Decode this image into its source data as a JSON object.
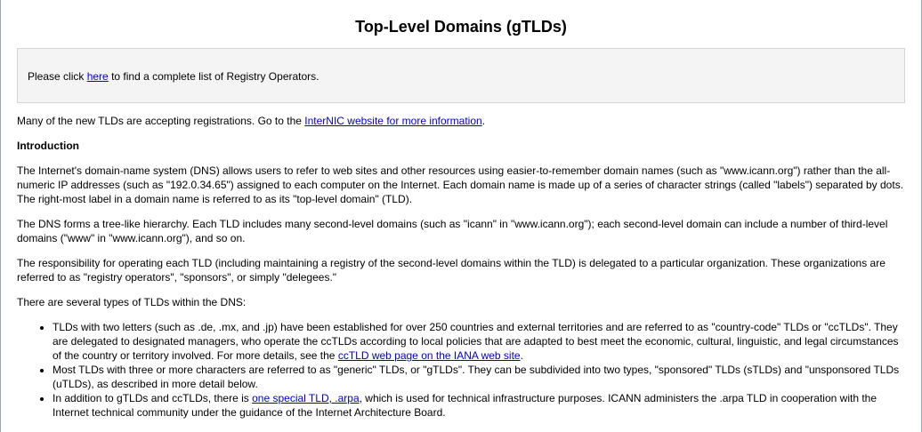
{
  "title": "Top-Level Domains (gTLDs)",
  "notice": {
    "before": "Please click ",
    "link": "here",
    "after": " to find a complete list of Registry Operators."
  },
  "intro_link_para": {
    "before": "Many of the new TLDs are accepting registrations. Go to the ",
    "link": "InterNIC website for more information",
    "after": "."
  },
  "introduction_heading": "Introduction",
  "paragraphs": [
    "The Internet's domain-name system (DNS) allows users to refer to web sites and other resources using easier-to-remember domain names (such as \"www.icann.org\") rather than the all-numeric IP addresses (such as \"192.0.34.65\") assigned to each computer on the Internet. Each domain name is made up of a series of character strings (called \"labels\") separated by dots. The right-most label in a domain name is referred to as its \"top-level domain\" (TLD).",
    "The DNS forms a tree-like hierarchy. Each TLD includes many second-level domains (such as \"icann\" in \"www.icann.org\"); each second-level domain can include a number of third-level domains (\"www\" in \"www.icann.org\"), and so on.",
    "The responsibility for operating each TLD (including maintaining a registry of the second-level domains within the TLD) is delegated to a particular organization. These organizations are referred to as \"registry operators\", \"sponsors\", or simply \"delegees.\"",
    "There are several types of TLDs within the DNS:"
  ],
  "bullets": [
    {
      "before": "TLDs with two letters (such as .de, .mx, and .jp) have been established for over 250 countries and external territories and are referred to as \"country-code\" TLDs or \"ccTLDs\". They are delegated to designated managers, who operate the ccTLDs according to local policies that are adapted to best meet the economic, cultural, linguistic, and legal circumstances of the country or territory involved. For more details, see the ",
      "link": "ccTLD web page on the IANA web site",
      "after": "."
    },
    {
      "before": "Most TLDs with three or more characters are referred to as \"generic\" TLDs, or \"gTLDs\". They can be subdivided into two types, \"sponsored\" TLDs (sTLDs) and \"unsponsored TLDs (uTLDs), as described in more detail below.",
      "link": "",
      "after": ""
    },
    {
      "before": "In addition to gTLDs and ccTLDs, there is ",
      "link": "one special TLD, .arpa",
      "after": ", which is used for technical infrastructure purposes. ICANN administers the .arpa TLD in cooperation with the Internet technical community under the guidance of the Internet Architecture Board."
    }
  ]
}
